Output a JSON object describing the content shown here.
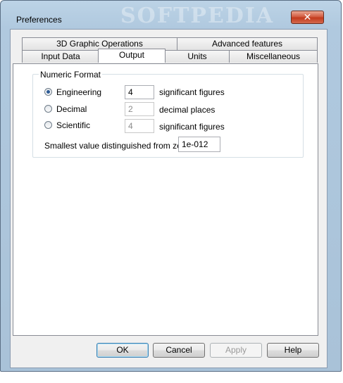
{
  "window": {
    "title": "Preferences",
    "watermark": "SOFTPEDIA",
    "close_glyph": "✕"
  },
  "tabs": {
    "row_back": [
      {
        "label": "3D Graphic Operations"
      },
      {
        "label": "Advanced features"
      }
    ],
    "row_front": [
      {
        "label": "Input Data"
      },
      {
        "label": "Output"
      },
      {
        "label": "Units"
      },
      {
        "label": "Miscellaneous"
      }
    ],
    "active": "Output"
  },
  "numeric_format": {
    "legend": "Numeric Format",
    "options": [
      {
        "label": "Engineering",
        "checked": true,
        "value": "4",
        "unit": "significant figures",
        "enabled": true
      },
      {
        "label": "Decimal",
        "checked": false,
        "value": "2",
        "unit": "decimal places",
        "enabled": false
      },
      {
        "label": "Scientific",
        "checked": false,
        "value": "4",
        "unit": "significant figures",
        "enabled": false
      }
    ],
    "smallest_label": "Smallest value distinguished from zero",
    "smallest_value": "1e-012"
  },
  "buttons": {
    "ok": "OK",
    "cancel": "Cancel",
    "apply": "Apply",
    "help": "Help"
  }
}
